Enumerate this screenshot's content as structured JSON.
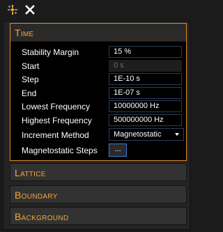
{
  "toolbar": {
    "pin_icon": "pin-icon",
    "close_icon": "close-icon"
  },
  "colors": {
    "accent": "#f3a63b",
    "field_border": "#2a3e58",
    "button_border": "#3b7ad1"
  },
  "sections": {
    "time": {
      "title": "Time",
      "fields": {
        "stability_margin": {
          "label": "Stability Margin",
          "value": "15 %"
        },
        "start": {
          "label": "Start",
          "value": "0 s"
        },
        "step": {
          "label": "Step",
          "value": "1E-10 s"
        },
        "end": {
          "label": "End",
          "value": "1E-07 s"
        },
        "lowest_frequency": {
          "label": "Lowest Frequency",
          "value": "10000000 Hz"
        },
        "highest_frequency": {
          "label": "Highest Frequency",
          "value": "500000000 Hz"
        },
        "increment_method": {
          "label": "Increment Method",
          "value": "Magnetostatic"
        },
        "magnetostatic_steps": {
          "label": "Magnetostatic Steps",
          "button": "..."
        }
      }
    },
    "lattice": {
      "title": "Lattice"
    },
    "boundary": {
      "title": "Boundary"
    },
    "background": {
      "title": "Background"
    }
  }
}
